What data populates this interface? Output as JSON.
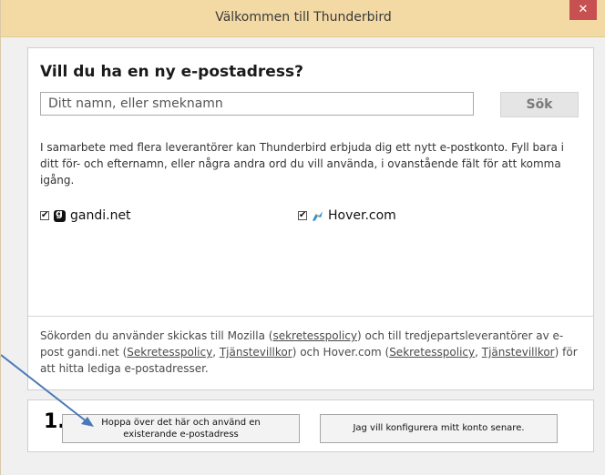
{
  "window": {
    "title": "Välkommen till Thunderbird",
    "close_symbol": "✕"
  },
  "search": {
    "heading": "Vill du ha en ny e-postadress?",
    "placeholder": "Ditt namn, eller smeknamn",
    "button_label": "Sök"
  },
  "info_text": "I samarbete med flera leverantörer kan Thunderbird erbjuda dig ett nytt e-postkonto. Fyll bara i ditt för- och efternamn, eller några andra ord du vill använda, i ovanstående fält för att komma igång.",
  "providers": [
    {
      "name": "gandi.net",
      "checked": true,
      "icon": "gandi-icon"
    },
    {
      "name": "Hover.com",
      "checked": true,
      "icon": "hover-icon"
    }
  ],
  "footer": {
    "t1": "Sökorden du använder skickas till Mozilla (",
    "l1": "sekretesspolicy",
    "t2": ") och till tredjepartsleverantörer av e-post gandi.net (",
    "l2": "Sekretesspolicy",
    "t3": ", ",
    "l3": "Tjänstevillkor",
    "t4": ") och Hover.com (",
    "l4": "Sekretesspolicy",
    "t5": ", ",
    "l5": "Tjänstevillkor",
    "t6": ") för att hitta lediga e-postadresser."
  },
  "actions": {
    "step_number": "1.",
    "skip_line1": "Hoppa över det här och använd en",
    "skip_line2": "existerande e-postadress",
    "later_label": "Jag vill konfigurera mitt konto senare."
  },
  "colors": {
    "titlebar": "#f3d9a4",
    "close_button": "#c75050",
    "annotation_arrow": "#4a78b8"
  }
}
